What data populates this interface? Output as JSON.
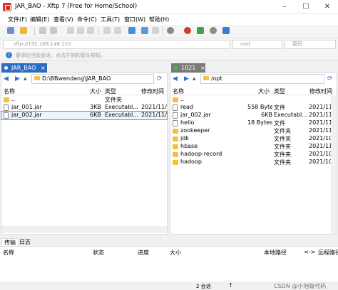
{
  "window": {
    "title": "JAR_BAO - Xftp 7 (Free for Home/School)"
  },
  "menu": [
    "文件(F)",
    "编辑(E)",
    "查看(V)",
    "命令(C)",
    "工具(T)",
    "窗口(W)",
    "帮助(H)"
  ],
  "address": {
    "host_placeholder": "sftp://192.168.146.110",
    "user_placeholder": "root",
    "password_placeholder": "密码"
  },
  "hint": "要添加当前会话，点击左侧的箭头按钮。",
  "left_tab": {
    "label": "JAR_BAO",
    "close": "×"
  },
  "right_tab": {
    "label": "1021",
    "close": "×"
  },
  "left_pane": {
    "path": "D:\\BBwendang\\JAR_BAO",
    "columns": {
      "name": "名称",
      "size": "大小",
      "type": "类型",
      "modified": "修改时间"
    },
    "rows": [
      {
        "name": "..",
        "size": "",
        "type": "文件夹",
        "modified": ""
      },
      {
        "name": "jar_001.jar",
        "size": "3KB",
        "type": "Executabl...",
        "modified": "2021/11/1"
      },
      {
        "name": "jar_002.jar",
        "size": "6KB",
        "type": "Executabl...",
        "modified": "2021/11/2"
      }
    ]
  },
  "right_pane": {
    "path": "/opt",
    "columns": {
      "name": "名称",
      "size": "大小",
      "type": "类型",
      "modified": "修改时间"
    },
    "rows": [
      {
        "name": "..",
        "size": "",
        "type": "",
        "modified": ""
      },
      {
        "name": "read",
        "size": "558 Bytes",
        "type": "文件",
        "modified": "2021/11/1"
      },
      {
        "name": "jar_002.jar",
        "size": "6KB",
        "type": "Executabl...",
        "modified": "2021/11/1"
      },
      {
        "name": "hello",
        "size": "18 Bytes",
        "type": "文件",
        "modified": "2021/11/1"
      },
      {
        "name": "zookeeper",
        "size": "",
        "type": "文件夹",
        "modified": "2021/11/1"
      },
      {
        "name": "jdk",
        "size": "",
        "type": "文件夹",
        "modified": "2021/10/2"
      },
      {
        "name": "hbase",
        "size": "",
        "type": "文件夹",
        "modified": "2021/11/1"
      },
      {
        "name": "hadoop-record",
        "size": "",
        "type": "文件夹",
        "modified": "2021/10/2"
      },
      {
        "name": "hadoop",
        "size": "",
        "type": "文件夹",
        "modified": "2021/10/2"
      }
    ]
  },
  "transfer": {
    "tabs": [
      "传输",
      "日志"
    ],
    "columns": {
      "name": "名称",
      "status": "状态",
      "progress": "进度",
      "size": "大小",
      "local_path": "本地路径",
      "arrow": "<->",
      "remote_path": "远程路径"
    }
  },
  "status": {
    "sessions": "2 会话",
    "arrow": "↑",
    "watermark": "CSDN @小旭敲代码"
  },
  "colors": {
    "tab_left": "#2b6cc4",
    "tab_right": "#7a7a7a",
    "folder": "#f5c141"
  }
}
